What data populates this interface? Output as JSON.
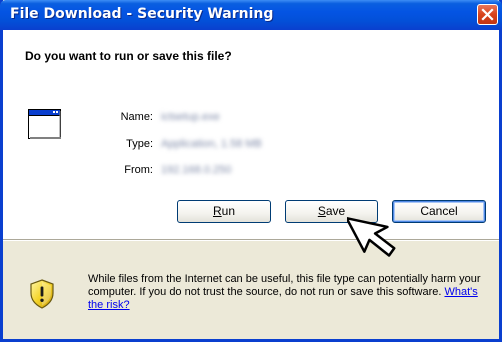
{
  "window": {
    "title": "File Download - Security Warning",
    "accent_color": "#0a5fe0",
    "close_color": "#d8431b"
  },
  "dialog": {
    "question": "Do you want to run or save this file?",
    "file_icon": "application-window-icon",
    "fields": [
      {
        "label": "Name:",
        "value": "ictsetup.exe"
      },
      {
        "label": "Type:",
        "value": "Application, 1.58 MB"
      },
      {
        "label": "From:",
        "value": "192.168.0.250"
      }
    ],
    "buttons": {
      "run": "Run",
      "save": "Save",
      "cancel": "Cancel"
    }
  },
  "warning": {
    "icon": "shield-warning-icon",
    "text": "While files from the Internet can be useful, this file type can potentially harm your computer. If you do not trust the source, do not run or save this software.",
    "link": "What's the risk?"
  },
  "cursor": {
    "icon": "arrow-cursor-icon"
  }
}
